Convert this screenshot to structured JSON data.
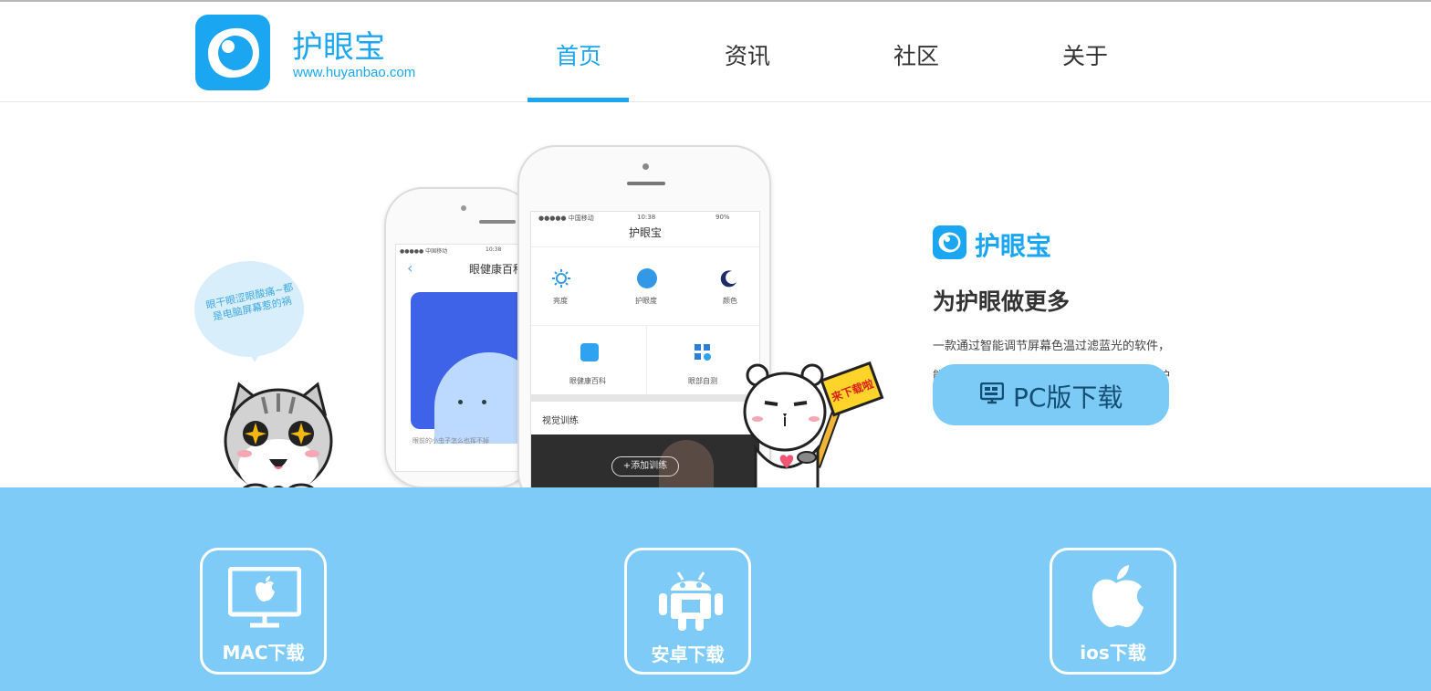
{
  "header": {
    "brand_name": "护眼宝",
    "brand_url": "www.huyanbao.com",
    "nav": [
      {
        "label": "首页",
        "active": true
      },
      {
        "label": "资讯",
        "active": false
      },
      {
        "label": "社区",
        "active": false
      },
      {
        "label": "关于",
        "active": false
      }
    ]
  },
  "hero": {
    "bubble_text": "眼干眼涩眼酸痛~都是电脑屏幕惹的祸",
    "sign_text": "来下载啦",
    "back_phone": {
      "status_left": "●●●●● 中国移动",
      "status_time": "10:38",
      "title": "眼健康百科",
      "card_caption": "眼前的小虫子怎么也挥不掉"
    },
    "front_phone": {
      "status_left": "●●●●● 中国移动",
      "status_time": "10:38",
      "status_right": "90%",
      "title": "护眼宝",
      "grid_top": [
        "亮度",
        "护眼度",
        "颜色"
      ],
      "grid_bottom": [
        "眼健康百科",
        "眼部自测"
      ],
      "section_title": "视觉训练",
      "add_button": "+添加训练"
    },
    "right_logo_text": "护眼宝",
    "slogan": "为护眼做更多",
    "description": "一款通过智能调节屏幕色温过滤蓝光的软件，能有效减少屏幕蓝光对眼睛的伤害，从而保护眼睛防止近视。",
    "pc_download": "PC版下载"
  },
  "downloads": [
    {
      "label": "MAC下载",
      "icon": "monitor-apple-icon"
    },
    {
      "label": "安卓下载",
      "icon": "android-icon"
    },
    {
      "label": "ios下载",
      "icon": "apple-icon"
    }
  ],
  "colors": {
    "accent": "#1aa6f0",
    "band": "#7ecbf8",
    "pc_button": "#7ccbf7",
    "pc_button_text": "#144e72"
  }
}
